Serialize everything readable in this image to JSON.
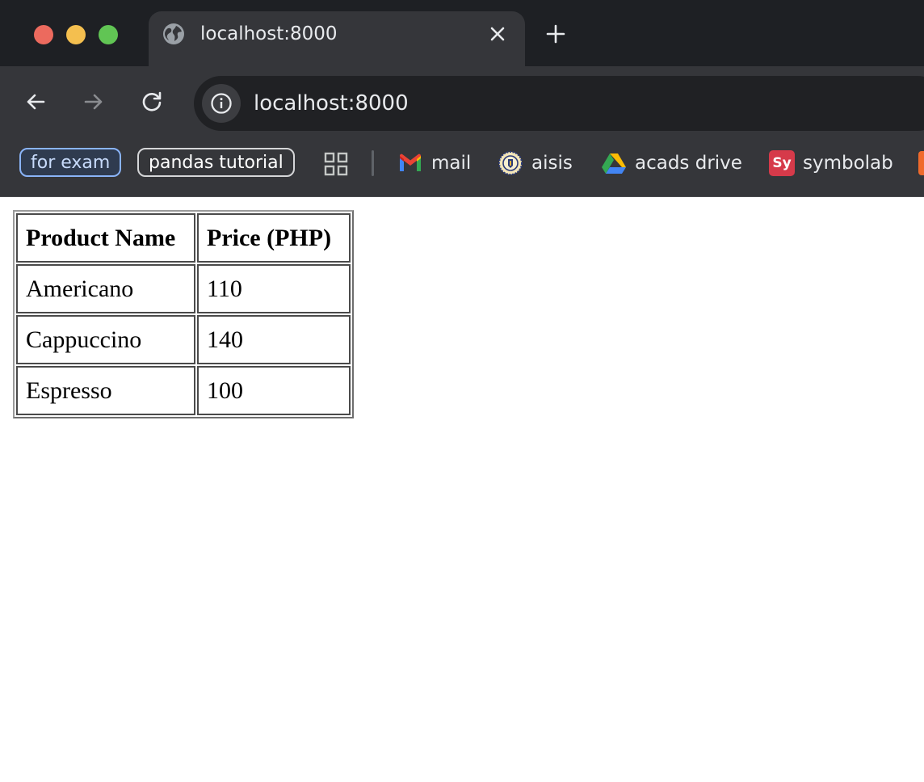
{
  "window": {
    "traffic_lights": [
      "close",
      "minimize",
      "zoom"
    ]
  },
  "tab": {
    "title": "localhost:8000",
    "icon": "globe-icon"
  },
  "toolbar": {
    "url": "localhost:8000"
  },
  "bookmarks": {
    "chips": [
      {
        "label": "for exam",
        "color": "#8ab4f8"
      },
      {
        "label": "pandas tutorial",
        "color": "#d5d6d8"
      }
    ],
    "items": [
      {
        "label": "mail",
        "icon": "gmail-icon"
      },
      {
        "label": "aisis",
        "icon": "aisis-seal-icon"
      },
      {
        "label": "acads drive",
        "icon": "google-drive-icon"
      },
      {
        "label": "symbolab",
        "icon": "symbolab-icon",
        "badge": "Sy"
      }
    ]
  },
  "table": {
    "headers": [
      "Product Name",
      "Price (PHP)"
    ],
    "rows": [
      [
        "Americano",
        "110"
      ],
      [
        "Cappuccino",
        "140"
      ],
      [
        "Espresso",
        "100"
      ]
    ]
  },
  "colors": {
    "tabstrip_bg": "#1e2024",
    "toolbar_bg": "#35363a",
    "omnibox_bg": "#202124",
    "traffic_red": "#ec6a5e",
    "traffic_yellow": "#f4bf4f",
    "traffic_green": "#61c554"
  }
}
